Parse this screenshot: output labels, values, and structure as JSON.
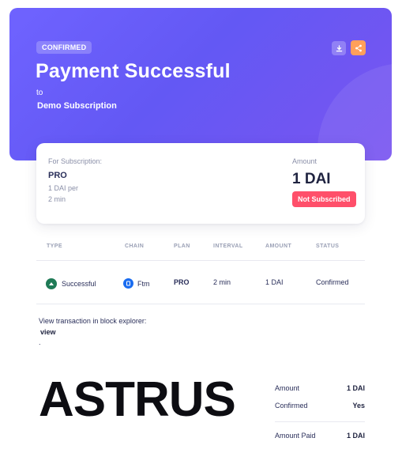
{
  "hero": {
    "badge": "CONFIRMED",
    "title": "Payment Successful",
    "to": "to",
    "subscription_name": "Demo Subscription",
    "download_icon": "download-icon",
    "share_icon": "share-icon",
    "colors": {
      "gradient_start": "#6f63ff",
      "gradient_end": "#7a55f0",
      "share_button": "#ffa05a"
    }
  },
  "subscription_card": {
    "label": "For Subscription:",
    "plan": "PRO",
    "price": "1 DAI per",
    "interval": "2 min",
    "amount_label": "Amount",
    "amount_value": "1 DAI",
    "status_badge": "Not Subscribed",
    "status_color": "#ff4f6a"
  },
  "table": {
    "headers": [
      "TYPE",
      "CHAIN",
      "PLAN",
      "INTERVAL",
      "AMOUNT",
      "STATUS"
    ],
    "row": {
      "type": "Successful",
      "type_icon": "success-icon",
      "chain": "Ftm",
      "chain_icon": "fantom-icon",
      "plan": "PRO",
      "interval": "2 min",
      "amount": "1 DAI",
      "status": "Confirmed"
    }
  },
  "explorer": {
    "text": "View transaction in block explorer:",
    "link": "view",
    "dot": "."
  },
  "logo": {
    "text": "ASTRUS"
  },
  "summary": {
    "amount_label": "Amount",
    "amount_value": "1 DAI",
    "confirmed_label": "Confirmed",
    "confirmed_value": "Yes",
    "paid_label": "Amount Paid",
    "paid_value": "1 DAI"
  }
}
